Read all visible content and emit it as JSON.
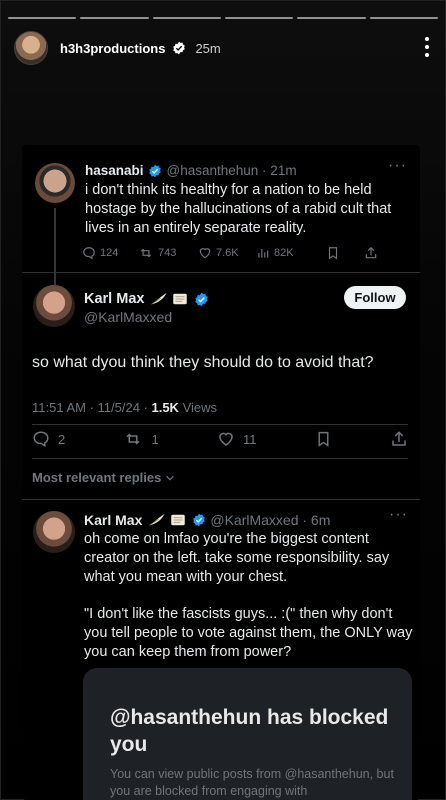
{
  "story": {
    "username": "h3h3productions",
    "time": "25m",
    "progress_segments": 6
  },
  "quoted_tweet": {
    "name": "hasanabi",
    "handle_time": "@hasanthehun · 21m",
    "text": "i don't think its healthy for a nation to be held hostage by the hallucinations of a rabid cult that lives in an entirely separate reality.",
    "replies": "124",
    "retweets": "743",
    "likes": "7.6K",
    "views": "82K"
  },
  "main_tweet": {
    "name": "Karl Max",
    "handle": "@KarlMaxxed",
    "follow_label": "Follow",
    "text": "so what dyou think they should do to avoid that?",
    "timestamp": "11:51 AM · 11/5/24 · ",
    "views_count": "1.5K",
    "views_label": " Views",
    "replies": "2",
    "retweets": "1",
    "likes": "11",
    "relevant_label": "Most relevant replies"
  },
  "reply": {
    "name": "Karl Max",
    "handle_time": "@KarlMaxxed · 6m",
    "text_1": "oh come on lmfao you're the biggest content creator on the left. take some responsibility. say what you mean with your chest.",
    "text_2": "\"I don't like the fascists guys... :(\" then why don't you tell people to vote against them, the ONLY way you can keep them from power?"
  },
  "blocked_notice": {
    "title": "@hasanthehun has blocked you",
    "description": "You can view public posts from @hasanthehun, but you are blocked from engaging with"
  },
  "colors": {
    "verified": "#1d9bf0",
    "muted": "#71767b",
    "text": "#e7e9ea"
  }
}
